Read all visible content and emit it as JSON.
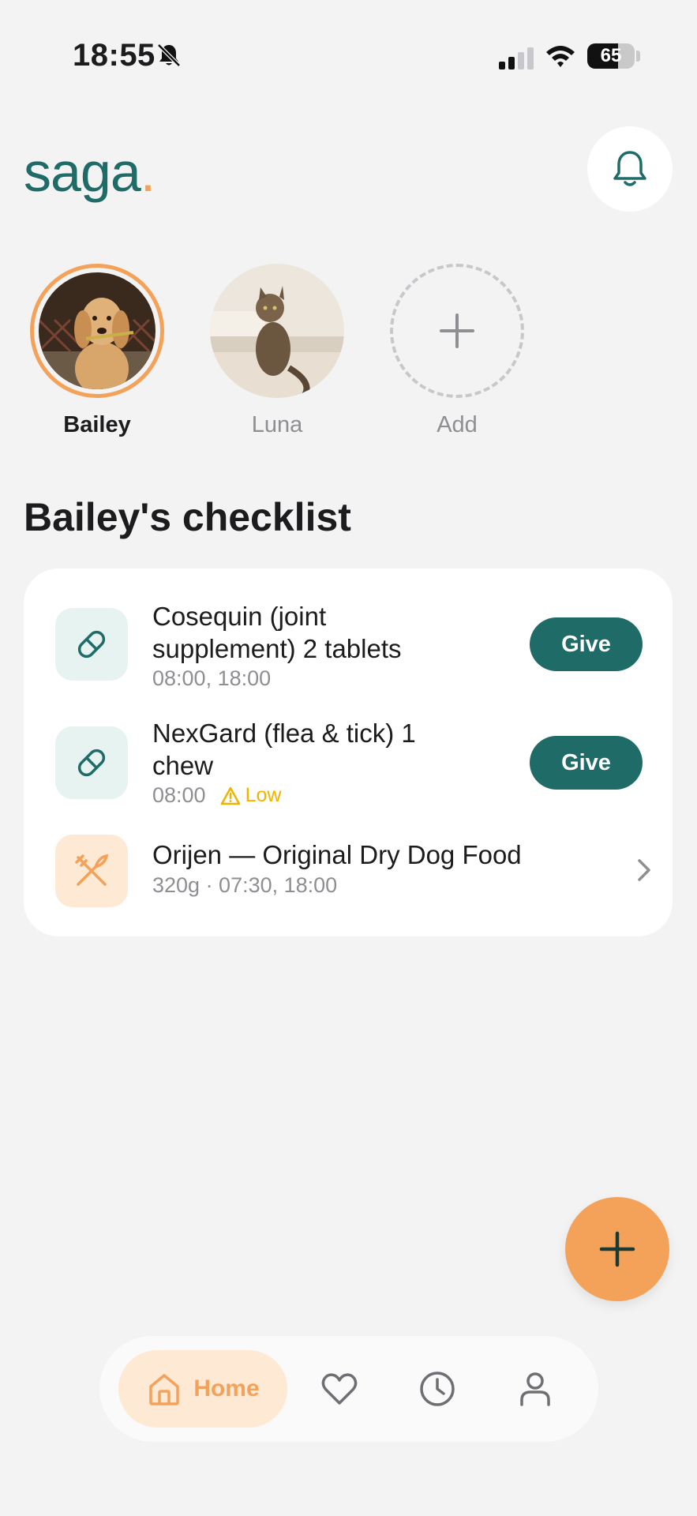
{
  "status_bar": {
    "time": "18:55",
    "battery_percent": 65,
    "battery_label": "65",
    "icons": [
      "bell-slash-icon",
      "signal-icon",
      "wifi-icon",
      "battery-icon"
    ]
  },
  "header": {
    "logo_text": "saga",
    "logo_dot": ".",
    "notification_icon": "bell-icon"
  },
  "pets": [
    {
      "name": "Bailey",
      "selected": true,
      "photo": "golden-retriever-photo"
    },
    {
      "name": "Luna",
      "selected": false,
      "photo": "tabby-cat-photo"
    }
  ],
  "add_pet_label": "Add",
  "checklist": {
    "title": "Bailey's checklist",
    "items": [
      {
        "icon": "pill-icon",
        "title_line1": "Cosequin (joint",
        "title_line2": "supplement) 2 tablets",
        "subtitle": "08:00, 18:00",
        "action_label": "Give"
      },
      {
        "icon": "pill-icon",
        "title_line1": "NexGard (flea & tick) 1",
        "title_line2": "chew",
        "subtitle": "08:00",
        "badge": "Low",
        "badge_icon": "warning-icon",
        "action_label": "Give"
      },
      {
        "icon": "fork-knife-icon",
        "title_line1": "Orijen — Original Dry Dog Food",
        "subtitle": "320g · 07:30, 18:00",
        "action_icon": "chevron-right-icon"
      }
    ]
  },
  "fab_icon": "plus-icon",
  "bottom_nav": {
    "items": [
      {
        "label": "Home",
        "icon": "home-icon",
        "active": true
      },
      {
        "icon": "heart-icon"
      },
      {
        "icon": "clock-icon"
      },
      {
        "icon": "user-icon"
      }
    ]
  },
  "colors": {
    "primary": "#1f6b68",
    "accent": "#f4a25a",
    "warning": "#f0b400",
    "background": "#f3f3f3"
  }
}
